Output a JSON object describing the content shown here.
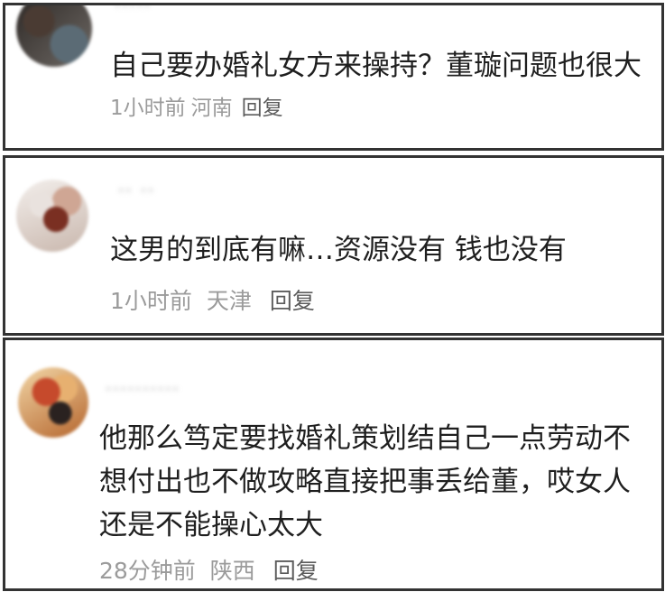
{
  "comments": [
    {
      "username": "·····",
      "text": "自己要办婚礼女方来操持？董璇问题也很大",
      "time": "1小时前",
      "location": "河南",
      "reply": "回复"
    },
    {
      "username": "·· ··",
      "text": "这男的到底有嘛…资源没有 钱也没有",
      "time": "1小时前",
      "location": "天津",
      "reply": "回复"
    },
    {
      "username": "··········",
      "text": "他那么笃定要找婚礼策划结自己一点劳动不想付出也不做攻略直接把事丢给董，哎女人还是不能操心太大",
      "time": "28分钟前",
      "location": "陕西",
      "reply": "回复"
    }
  ]
}
